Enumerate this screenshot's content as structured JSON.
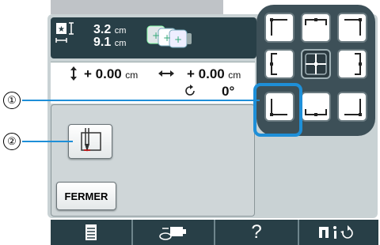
{
  "header": {
    "width_value": "3.2",
    "width_unit": "cm",
    "height_value": "9.1",
    "height_unit": "cm"
  },
  "info": {
    "vertical_offset": "+ 0.00",
    "vertical_unit": "cm",
    "horizontal_offset": "+ 0.00",
    "horizontal_unit": "cm",
    "rotation": "0°"
  },
  "buttons": {
    "close_label": "FERMER"
  },
  "callouts": {
    "one": "①",
    "two": "②"
  },
  "bottom_bar": {
    "help_label": "?"
  },
  "colors": {
    "panel": "#c9d2d4",
    "header": "#283f47",
    "grid": "#3d5058",
    "highlight": "#1e8fd8"
  },
  "grid_buttons": [
    "top-left",
    "top-center",
    "top-right",
    "middle-left",
    "center",
    "middle-right",
    "bottom-left",
    "bottom-center",
    "bottom-right"
  ]
}
